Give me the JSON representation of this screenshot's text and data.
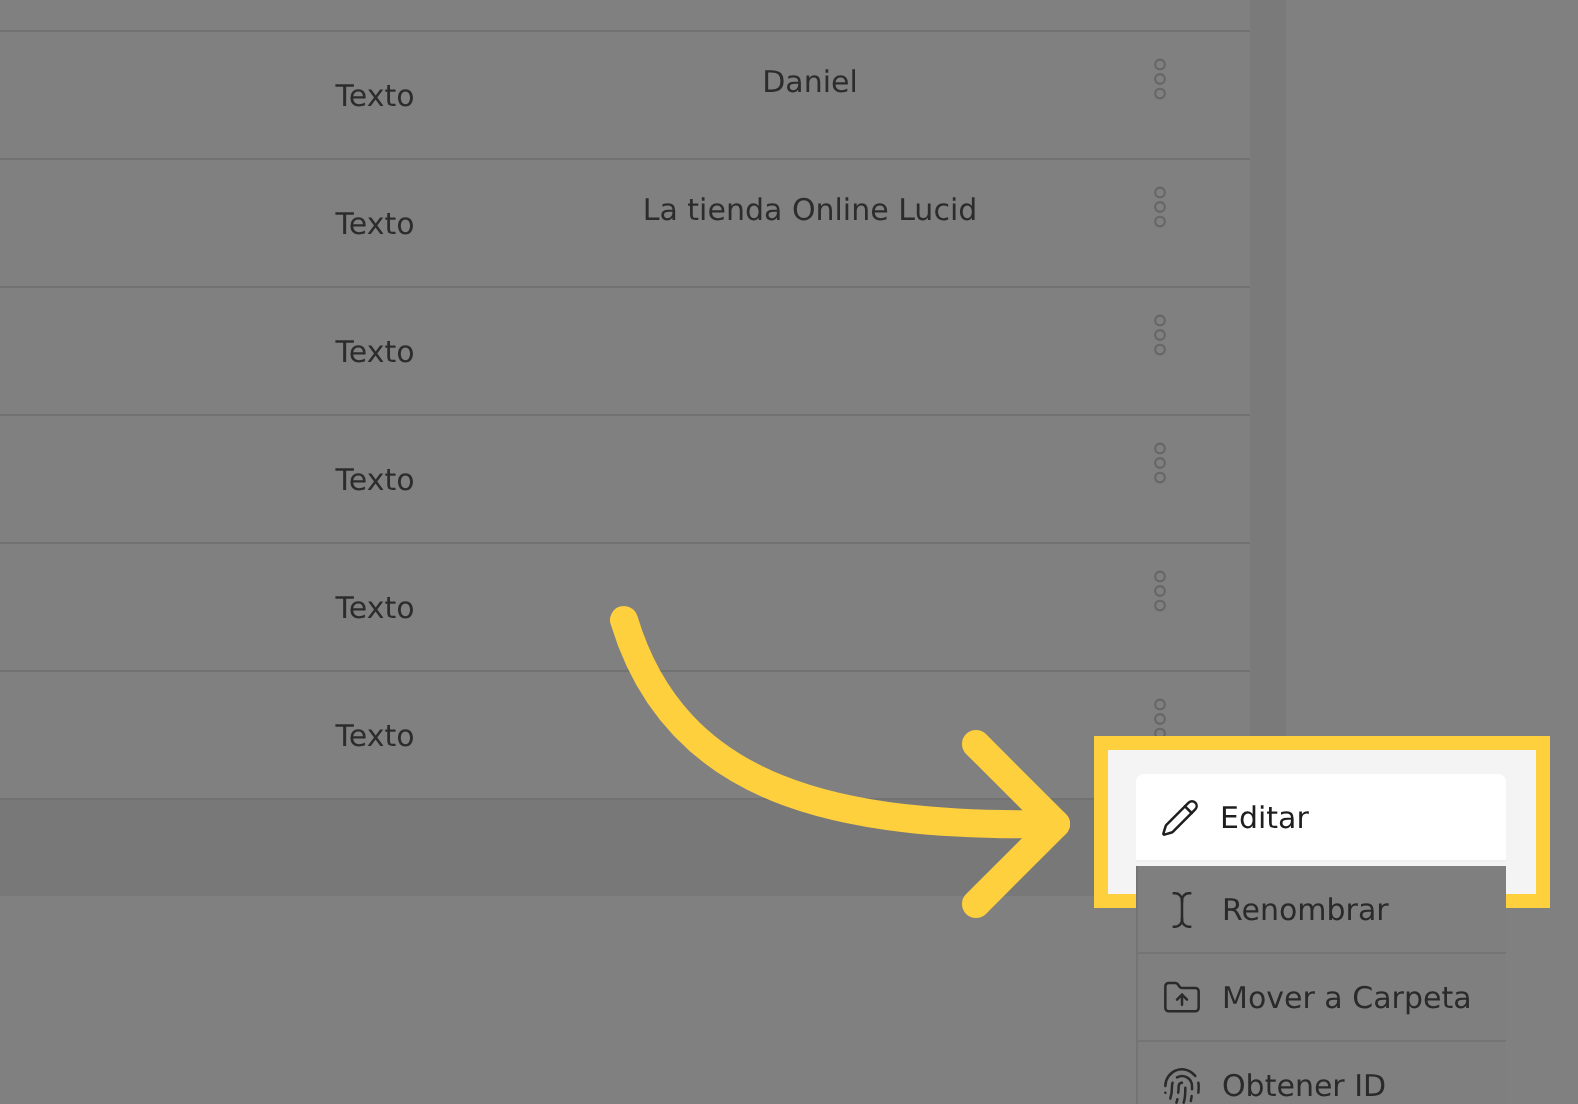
{
  "table": {
    "rows": [
      {
        "type": "Texto",
        "name": "Daniel"
      },
      {
        "type": "Texto",
        "name": "La tienda Online Lucid"
      },
      {
        "type": "Texto"
      },
      {
        "type": "Texto"
      },
      {
        "type": "Texto"
      },
      {
        "type": "Texto"
      }
    ]
  },
  "context_menu": {
    "items": [
      {
        "kind": "edit",
        "label": "Editar",
        "selected": true
      },
      {
        "kind": "rename",
        "label": "Renombrar",
        "selected": false
      },
      {
        "kind": "move",
        "label": "Mover a Carpeta",
        "selected": false
      },
      {
        "kind": "id",
        "label": "Obtener ID",
        "selected": false
      }
    ]
  }
}
